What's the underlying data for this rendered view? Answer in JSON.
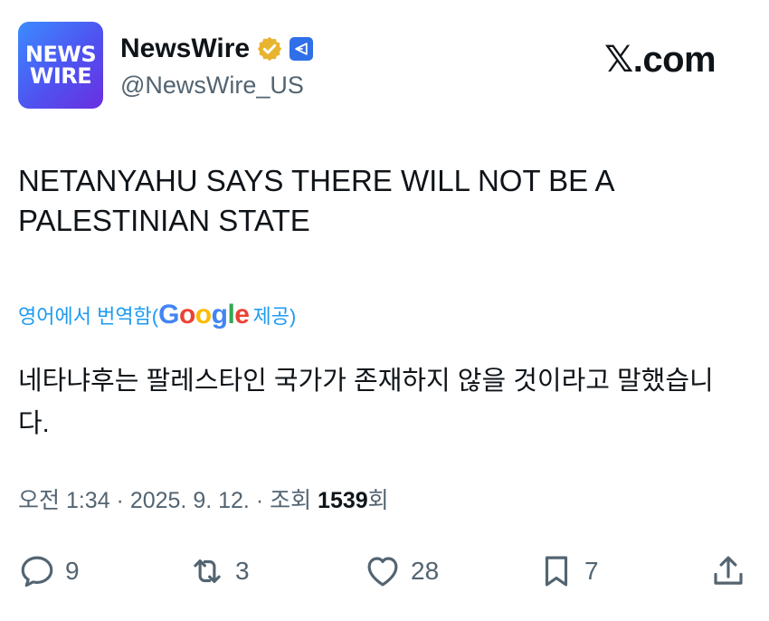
{
  "account": {
    "avatar_text": [
      "NEWS",
      "WIRE"
    ],
    "name": "NewsWire",
    "handle": "@NewsWire_US"
  },
  "site": "𝕏.com",
  "post": {
    "text": "NETANYAHU SAYS THERE WILL NOT BE A PALESTINIAN STATE",
    "translate_prefix": "영어에서 번역함(",
    "translate_google": "Google",
    "translate_suffix": " 제공)",
    "translation": "네타냐후는 팔레스타인 국가가 존재하지 않을 것이라고 말했습니다.",
    "meta_time": "오전 1:34 · 2025. 9. 12. · 조회 ",
    "meta_views": "1539",
    "meta_views_suffix": "회"
  },
  "actions": {
    "replies": "9",
    "reposts": "3",
    "likes": "28",
    "bookmarks": "7"
  },
  "icons": [
    "verified-badge-icon",
    "affiliate-badge-icon",
    "reply-icon",
    "repost-icon",
    "like-icon",
    "bookmark-icon",
    "share-icon"
  ],
  "colors": {
    "link": "#1d9bf0",
    "muted": "#536471",
    "text": "#0f1419",
    "verified_gold": "#e8b430"
  }
}
